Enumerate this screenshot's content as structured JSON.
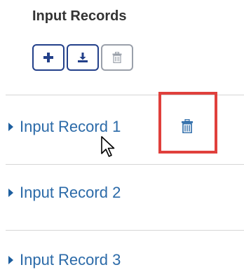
{
  "panel": {
    "title": "Input Records"
  },
  "toolbar": {
    "buttons": [
      {
        "name": "add",
        "icon": "plus-icon",
        "enabled": true
      },
      {
        "name": "download",
        "icon": "download-icon",
        "enabled": true
      },
      {
        "name": "delete",
        "icon": "trash-icon",
        "enabled": false
      }
    ]
  },
  "records": [
    {
      "label": "Input Record 1",
      "expanded": false,
      "delete_icon_visible": true
    },
    {
      "label": "Input Record 2",
      "expanded": false
    },
    {
      "label": "Input Record 3",
      "expanded": false
    }
  ],
  "colors": {
    "accent": "#23408a",
    "link": "#2b6aa8",
    "highlight": "#e0403c",
    "divider": "#d6d6d6",
    "disabled": "#9aa0aa"
  },
  "overlays": {
    "highlight_target": "record-1-delete-button",
    "cursor": "arrow-cursor-icon"
  }
}
